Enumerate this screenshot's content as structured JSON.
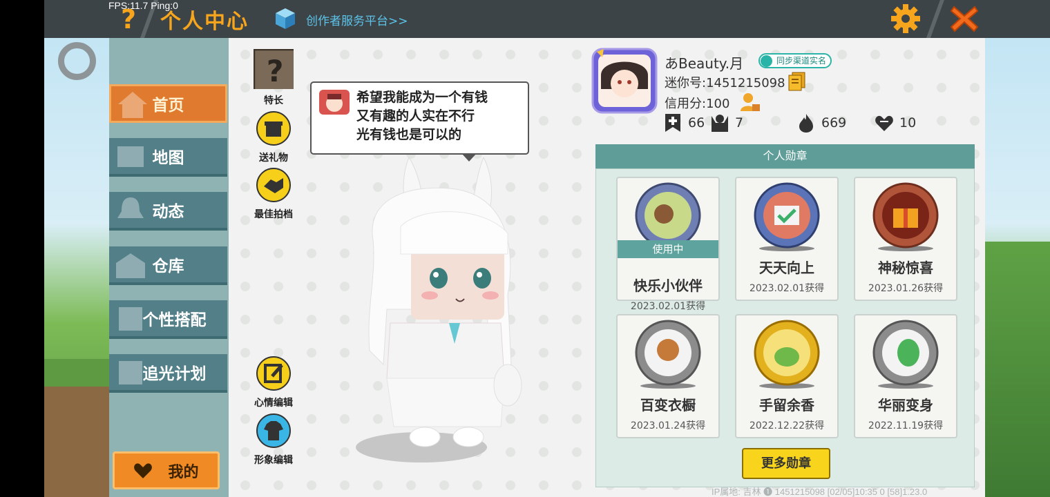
{
  "topbar": {
    "fps": "FPS:11.7  Ping:0",
    "help_symbol": "?",
    "title": "个人中心",
    "creator_link": "创作者服务平台>>"
  },
  "sidebar": {
    "items": [
      {
        "label": "首页",
        "icon": "house-icon",
        "active": true
      },
      {
        "label": "地图",
        "icon": "map-icon"
      },
      {
        "label": "动态",
        "icon": "bell-icon"
      },
      {
        "label": "仓库",
        "icon": "warehouse-icon"
      },
      {
        "label": "个性搭配",
        "icon": "outfit-icon"
      },
      {
        "label": "追光计划",
        "icon": "light-plan-icon"
      }
    ],
    "me_label": "我的"
  },
  "actions": {
    "skill": "特长",
    "gift": "送礼物",
    "partner": "最佳拍档",
    "mood_edit": "心情编辑",
    "look_edit": "形象编辑"
  },
  "mood": {
    "text_line1": "希望我能成为一个有钱",
    "text_line2": "又有趣的人实在不行",
    "text_line3": "光有钱也是可以的"
  },
  "profile": {
    "username": "あBeauty.月",
    "sync_badge": "同步渠道实名",
    "mini_id": "迷你号:1451215098",
    "credit": "信用分:100",
    "stats": {
      "bookmarks": "66",
      "fans": "7",
      "heat": "669",
      "likes": "10"
    }
  },
  "badges": {
    "header": "个人勋章",
    "in_use_label": "使用中",
    "items": [
      {
        "name": "快乐小伙伴",
        "date": "2023.02.01获得",
        "color": "#6f7fb4"
      },
      {
        "name": "天天向上",
        "date": "2023.02.01获得",
        "color": "#5b74b8"
      },
      {
        "name": "神秘惊喜",
        "date": "2023.01.26获得",
        "color": "#b0553a"
      },
      {
        "name": "百变衣橱",
        "date": "2023.01.24获得",
        "color": "#8c8c8c"
      },
      {
        "name": "手留余香",
        "date": "2022.12.22获得",
        "color": "#e3b01e"
      },
      {
        "name": "华丽变身",
        "date": "2022.11.19获得",
        "color": "#8c8c8c"
      }
    ],
    "more_label": "更多勋章"
  },
  "footer": {
    "text": "IP属地: 吉林  ❶    1451215098   [02/05]10:35 0  [58]1.23.0"
  },
  "colors": {
    "accent": "#f7a51c",
    "teal": "#5e9d98",
    "nav": "#527f88"
  }
}
